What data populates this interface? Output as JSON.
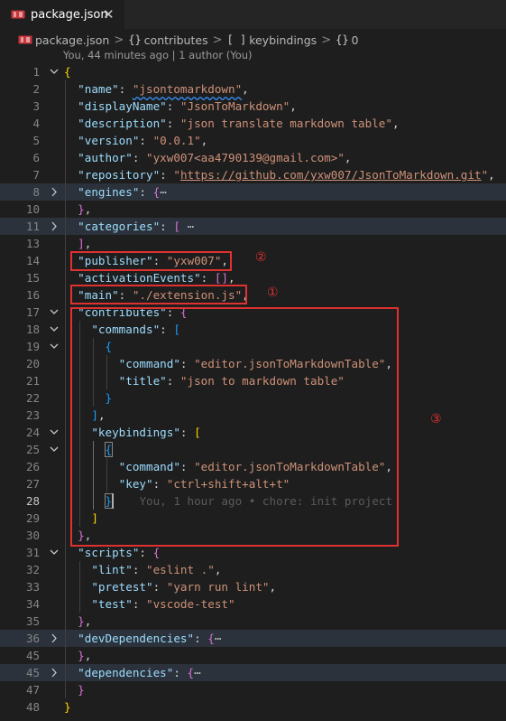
{
  "tab": {
    "title": "package.json",
    "close": "✕"
  },
  "breadcrumb": {
    "file": "package.json",
    "sep": ">",
    "items": [
      {
        "sym": "{}",
        "label": "contributes"
      },
      {
        "sym": "[ ]",
        "label": "keybindings"
      },
      {
        "sym": "{}",
        "label": "0"
      }
    ]
  },
  "codelens": "You, 44 minutes ago | 1 author (You)",
  "line_numbers": [
    "1",
    "2",
    "3",
    "4",
    "5",
    "6",
    "7",
    "8",
    "10",
    "11",
    "13",
    "14",
    "15",
    "16",
    "17",
    "18",
    "19",
    "20",
    "21",
    "22",
    "23",
    "24",
    "25",
    "26",
    "27",
    "28",
    "29",
    "30",
    "31",
    "32",
    "33",
    "34",
    "35",
    "36",
    "45",
    "47",
    "48"
  ],
  "code": {
    "name_key": "\"name\"",
    "name_val": "\"jsontomarkdown\"",
    "displayName_key": "\"displayName\"",
    "displayName_val": "\"JsonToMarkdown\"",
    "description_key": "\"description\"",
    "description_val": "\"json translate markdown table\"",
    "version_key": "\"version\"",
    "version_val": "\"0.0.1\"",
    "author_key": "\"author\"",
    "author_val": "\"yxw007<aa4790139@gmail.com>\"",
    "repository_key": "\"repository\"",
    "repository_q": "\"",
    "repository_url": "https://github.com/yxw007/JsonToMarkdown.git",
    "engines_key": "\"engines\"",
    "categories_key": "\"categories\"",
    "publisher_key": "\"publisher\"",
    "publisher_val": "\"yxw007\"",
    "activationEvents_key": "\"activationEvents\"",
    "main_key": "\"main\"",
    "main_val": "\"./extension.js\"",
    "contributes_key": "\"contributes\"",
    "commands_key": "\"commands\"",
    "command_key": "\"command\"",
    "command_val": "\"editor.jsonToMarkdownTable\"",
    "title_key": "\"title\"",
    "title_val": "\"json to markdown table\"",
    "keybindings_key": "\"keybindings\"",
    "key_key": "\"key\"",
    "key_val": "\"ctrl+shift+alt+t\"",
    "blame": "You, 1 hour ago • chore: init project",
    "scripts_key": "\"scripts\"",
    "lint_key": "\"lint\"",
    "lint_val": "\"eslint .\"",
    "pretest_key": "\"pretest\"",
    "pretest_val": "\"yarn run lint\"",
    "test_key": "\"test\"",
    "test_val": "\"vscode-test\"",
    "devDependencies_key": "\"devDependencies\"",
    "dependencies_key": "\"dependencies\"",
    "ellipsis": "⋯"
  },
  "annotations": {
    "one": "①",
    "two": "②",
    "three": "③"
  },
  "colors": {
    "box": "#e03131",
    "key": "#9cdcfe",
    "string": "#ce9178",
    "bracket1": "#ffd700",
    "bracket2": "#da70d6",
    "bracket3": "#179fff"
  },
  "icons": {
    "file": "json-file-icon",
    "fold_open": "chevron-down-icon",
    "fold_closed": "chevron-right-icon"
  }
}
